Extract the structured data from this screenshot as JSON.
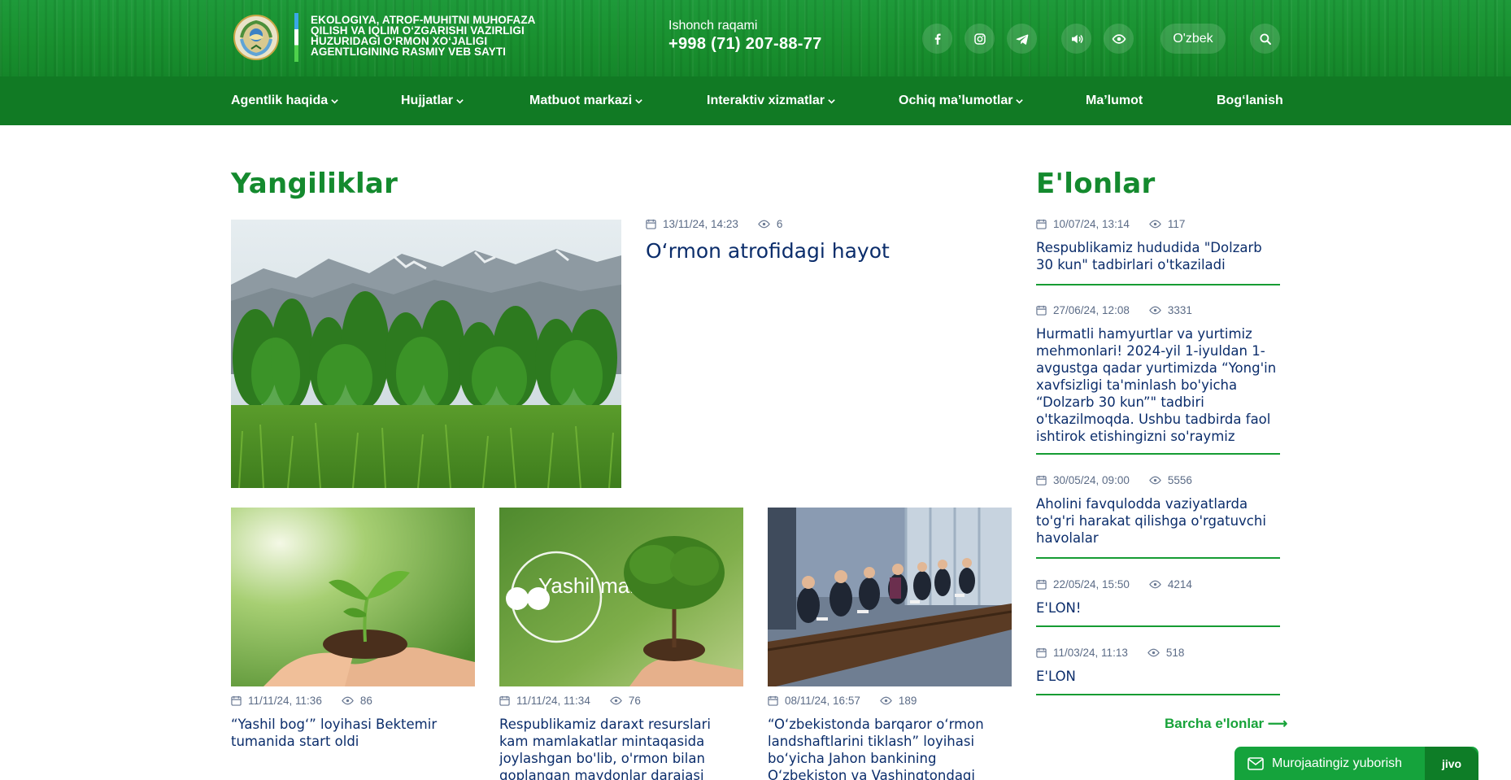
{
  "header": {
    "agency_title_lines": [
      "EKOLOGIYA, ATROF-MUHITNI MUHOFAZA",
      "QILISH VA IQLIM O‘ZGARISHI VAZIRLIGI",
      "HUZURIDAGI O‘RMON XO‘JALIGI",
      "AGENTLIGINING RASMIY VEB SAYTI"
    ],
    "hotline_label": "Ishonch raqami",
    "hotline_number": "+998 (71) 207-88-77",
    "social_icons": [
      "facebook-icon",
      "instagram-icon",
      "telegram-icon"
    ],
    "tool_icons": [
      "speaker-icon",
      "eye-icon"
    ],
    "language": "O'zbek",
    "search_icon": "search-icon"
  },
  "nav": {
    "items": [
      {
        "label": "Agentlik haqida",
        "dropdown": true
      },
      {
        "label": "Hujjatlar",
        "dropdown": true
      },
      {
        "label": "Matbuot markazi",
        "dropdown": true
      },
      {
        "label": "Interaktiv xizmatlar",
        "dropdown": true
      },
      {
        "label": "Ochiq ma’lumotlar",
        "dropdown": true
      },
      {
        "label": "Ma’lumot",
        "dropdown": false
      },
      {
        "label": "Bog‘lanish",
        "dropdown": false
      }
    ]
  },
  "news": {
    "title": "Yangiliklar",
    "lead": {
      "date": "13/11/24, 14:23",
      "views": "6",
      "title": "O‘rmon atrofidagi hayot"
    },
    "cards": [
      {
        "date": "11/11/24, 11:36",
        "views": "86",
        "title": "“Yashil bog‘” loyihasi Bektemir tumanida start oldi"
      },
      {
        "date": "11/11/24, 11:34",
        "views": "76",
        "title": "Respublikamiz daraxt resurslari kam mamlakatlar mintaqasida joylashgan bo'lib, o'rmon bilan qoplangan maydonlar darajasi",
        "image_text": "Yashil makon"
      },
      {
        "date": "08/11/24, 16:57",
        "views": "189",
        "title": "“O‘zbekistonda barqaror o‘rmon landshaftlarini tiklash” loyihasi bo‘yicha Jahon bankining O‘zbekiston va Vashingtondagi"
      }
    ]
  },
  "announcements": {
    "title": "E'lonlar",
    "items": [
      {
        "date": "10/07/24, 13:14",
        "views": "117",
        "title": "Respublikamiz hududida \"Dolzarb 30 kun\" tadbirlari o'tkaziladi"
      },
      {
        "date": "27/06/24, 12:08",
        "views": "3331",
        "title": "Hurmatli hamyurtlar va yurtimiz mehmonlari! 2024-yil 1-iyuldan 1-avgustga qadar yurtimizda “Yong'in xavfsizligi ta'minlash bo'yicha “Dolzarb 30 kun”\" tadbiri o'tkazilmoqda. Ushbu tadbirda faol ishtirok etishingizni so'raymiz"
      },
      {
        "date": "30/05/24, 09:00",
        "views": "5556",
        "title": "Aholini favqulodda vaziyatlarda to'g'ri harakat qilishga o'rgatuvchi havolalar"
      },
      {
        "date": "22/05/24, 15:50",
        "views": "4214",
        "title": "E'LON!"
      },
      {
        "date": "11/03/24, 11:13",
        "views": "518",
        "title": "E'LON"
      }
    ],
    "all_link": "Barcha e'lonlar ⟶"
  },
  "chat": {
    "label": "Murojaatingiz yuborish",
    "brand": "jivo"
  },
  "colors": {
    "header_green": "#19902f",
    "nav_green": "#117a24",
    "section_title_green": "#148a2e",
    "text_navy": "#0b2d6b",
    "meta_gray": "#5b6b86",
    "divider_green": "#169c33"
  }
}
